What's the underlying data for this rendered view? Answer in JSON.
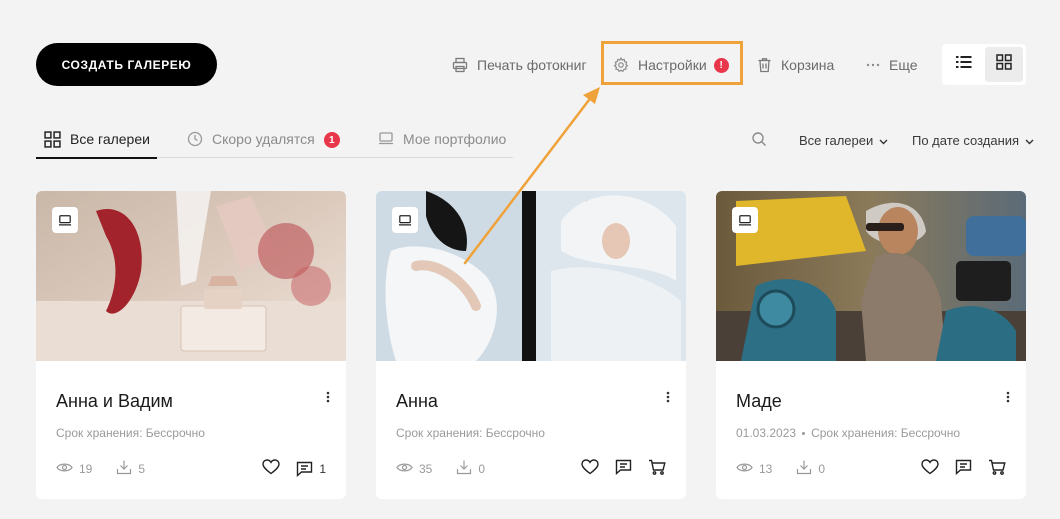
{
  "toolbar": {
    "create_gallery_label": "СОЗДАТЬ ГАЛЕРЕЮ",
    "print_label": "Печать фотокниг",
    "settings_label": "Настройки",
    "settings_alert": "!",
    "trash_label": "Корзина",
    "more_label": "Еще",
    "view_mode": "grid"
  },
  "tabs": [
    {
      "label": "Все галереи",
      "active": true
    },
    {
      "label": "Скоро удалятся",
      "badge": "1"
    },
    {
      "label": "Мое портфолио"
    }
  ],
  "filters": {
    "gallery_filter": "Все галереи",
    "sort": "По дате создания"
  },
  "cards": [
    {
      "title": "Анна и Вадим",
      "date": "",
      "storage": "Срок хранения: Бессрочно",
      "views": "19",
      "downloads": "5",
      "comments": "1",
      "has_cart": false
    },
    {
      "title": "Анна",
      "date": "",
      "storage": "Срок хранения: Бессрочно",
      "views": "35",
      "downloads": "0",
      "comments": "",
      "has_cart": true
    },
    {
      "title": "Маде",
      "date": "01.03.2023",
      "storage": "Срок хранения: Бессрочно",
      "views": "13",
      "downloads": "0",
      "comments": "",
      "has_cart": true
    }
  ],
  "colors": {
    "accent_highlight": "#f0a23a",
    "badge_red": "#e8364a",
    "primary_button": "#000000",
    "background": "#f3f3f3"
  }
}
